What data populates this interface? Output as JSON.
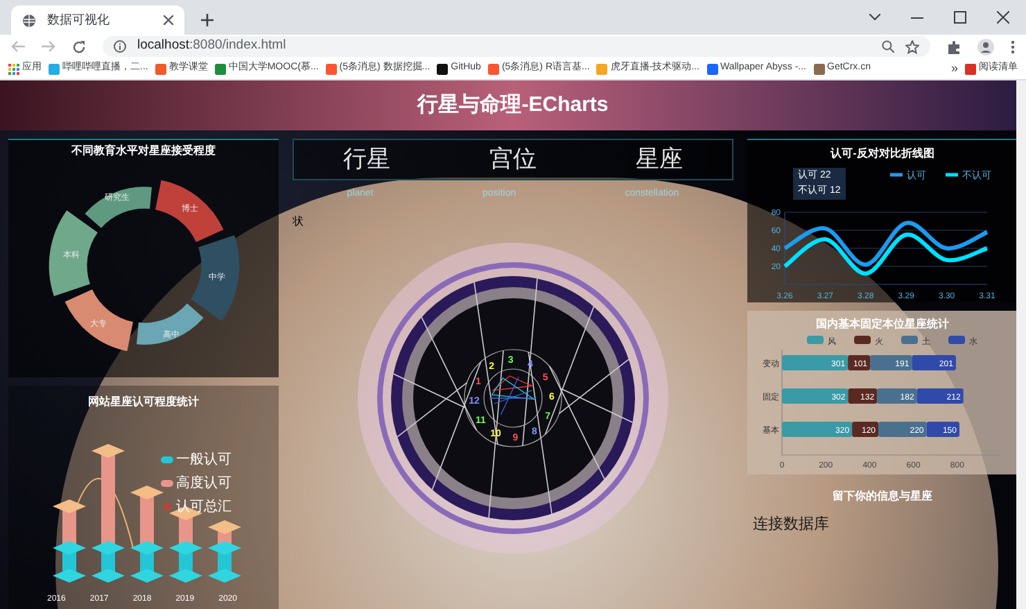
{
  "browser": {
    "tab_title": "数据可视化",
    "url_host": "localhost",
    "url_rest": ":8080/index.html",
    "bookmarks": [
      "应用",
      "哔哩哔哩直播，二...",
      "教学课堂",
      "中国大学MOOC(慕...",
      "(5条消息) 数据挖掘...",
      "GitHub",
      "(5条消息) R语言基...",
      "虎牙直播-技术驱动...",
      "Wallpaper Abyss -...",
      "GetCrx.cn"
    ],
    "more": "»",
    "reading_list": "阅读清单"
  },
  "page": {
    "title": "行星与命理-ECharts",
    "education_panel": {
      "title": "不同教育水平对星座接受程度",
      "segments": [
        {
          "label": "研究生",
          "color": "#5f9a80"
        },
        {
          "label": "博士",
          "color": "#c0413a"
        },
        {
          "label": "中学",
          "color": "#2f4f63"
        },
        {
          "label": "高中",
          "color": "#6aa6b3"
        },
        {
          "label": "大专",
          "color": "#d98b72"
        },
        {
          "label": "本科",
          "color": "#6fa88a"
        }
      ]
    },
    "recognition_panel": {
      "title": "网站星座认可程度统计",
      "legend": [
        {
          "label": "一般认可",
          "color": "#22c6d6"
        },
        {
          "label": "高度认可",
          "color": "#e8958a"
        },
        {
          "label": "认可总汇",
          "color": "#c0413a"
        }
      ],
      "years": [
        "2016",
        "2017",
        "2018",
        "2019",
        "2020"
      ]
    },
    "nav": {
      "items": [
        {
          "title": "行星",
          "subtitle": "planet"
        },
        {
          "title": "宫位",
          "subtitle": "position"
        },
        {
          "title": "星座",
          "subtitle": "constellation"
        }
      ],
      "side_note": "状"
    },
    "chart_wheel": {
      "houses": [
        "1",
        "2",
        "3",
        "4",
        "5",
        "6",
        "7",
        "8",
        "9",
        "10",
        "11",
        "12"
      ]
    },
    "line_panel": {
      "title": "认可-反对对比折线图",
      "tooltip": [
        {
          "label": "认可",
          "value": "22"
        },
        {
          "label": "不认可",
          "value": "12"
        }
      ],
      "chart_data": {
        "type": "line",
        "categories": [
          "3.26",
          "3.27",
          "3.28",
          "3.29",
          "3.30",
          "3.31"
        ],
        "ylim": [
          0,
          80
        ],
        "yticks": [
          20,
          40,
          60,
          80
        ],
        "grid": true,
        "legend": "top-right",
        "series": [
          {
            "name": "认可",
            "color": "#1a9cf0",
            "values": [
              40,
              62,
              22,
              68,
              40,
              58
            ]
          },
          {
            "name": "不认可",
            "color": "#00e0ff",
            "values": [
              20,
              50,
              12,
              55,
              27,
              40
            ]
          }
        ]
      }
    },
    "bar_panel": {
      "title": "国内基本固定本位星座统计",
      "chart_data": {
        "type": "bar",
        "orientation": "horizontal",
        "stacked": true,
        "data_labels": true,
        "categories": [
          "变动",
          "固定",
          "基本"
        ],
        "xlim": [
          0,
          1000
        ],
        "xticks": [
          0,
          200,
          400,
          600,
          800
        ],
        "legend": "top",
        "series": [
          {
            "name": "风",
            "color": "#3a9aa6",
            "values": [
              301,
              302,
              320
            ]
          },
          {
            "name": "火",
            "color": "#5a2a22",
            "values": [
              101,
              132,
              120
            ]
          },
          {
            "name": "土",
            "color": "#4a7090",
            "values": [
              191,
              182,
              220
            ]
          },
          {
            "name": "水",
            "color": "#2f4aa8",
            "values": [
              201,
              212,
              150
            ]
          }
        ]
      }
    },
    "info_panel": {
      "title": "留下你的信息与星座",
      "link": "连接数据库"
    }
  }
}
